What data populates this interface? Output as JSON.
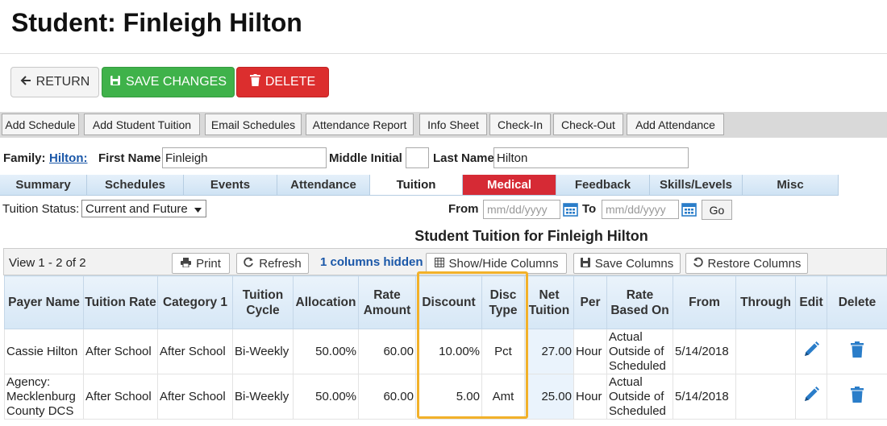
{
  "page_title": "Student: Finleigh Hilton",
  "actions": {
    "return_label": "RETURN",
    "save_label": "SAVE CHANGES",
    "delete_label": "DELETE"
  },
  "toolbar": [
    "Add Schedule",
    "Add Student Tuition",
    "Email Schedules",
    "Attendance Report",
    "Info Sheet",
    "Check-In",
    "Check-Out",
    "Add Attendance"
  ],
  "student": {
    "family_label": "Family:",
    "family_link": "Hilton:",
    "first_name_label": "First Name",
    "first_name": "Finleigh",
    "middle_initial_label": "Middle Initial",
    "middle_initial": "",
    "last_name_label": "Last Name",
    "last_name": "Hilton"
  },
  "tabs": [
    "Summary",
    "Schedules",
    "Events",
    "Attendance",
    "Tuition",
    "Medical",
    "Feedback",
    "Skills/Levels",
    "Misc"
  ],
  "active_tab": "Tuition",
  "filters": {
    "status_label": "Tuition Status:",
    "status_value": "Current and Future",
    "from_label": "From",
    "to_label": "To",
    "date_placeholder": "mm/dd/yyyy",
    "go_label": "Go"
  },
  "grid": {
    "title": "Student Tuition for Finleigh Hilton",
    "view_text": "View 1 - 2 of 2",
    "print_label": "Print",
    "refresh_label": "Refresh",
    "hidden_text": "1 columns hidden",
    "show_hide_label": "Show/Hide Columns",
    "save_columns_label": "Save Columns",
    "restore_columns_label": "Restore Columns",
    "columns": [
      "Payer Name",
      "Tuition Rate",
      "Category 1",
      "Tuition Cycle",
      "Allocation",
      "Rate Amount",
      "Discount",
      "Disc Type",
      "Net Tuition",
      "Per",
      "Rate Based On",
      "From",
      "Through",
      "Edit",
      "Delete"
    ],
    "rows": [
      [
        "Cassie Hilton",
        "After School",
        "After School",
        "Bi-Weekly",
        "50.00%",
        "60.00",
        "10.00%",
        "Pct",
        "27.00",
        "Hour",
        "Actual Outside of Scheduled",
        "5/14/2018",
        ""
      ],
      [
        "Agency: Mecklenburg County DCS",
        "After School",
        "After School",
        "Bi-Weekly",
        "50.00%",
        "60.00",
        "5.00",
        "Amt",
        "25.00",
        "Hour",
        "Actual Outside of Scheduled",
        "5/14/2018",
        ""
      ]
    ]
  },
  "colors": {
    "save": "#3fb24a",
    "delete": "#dc2e2e",
    "link": "#1a57a8",
    "medical_tab": "#d62a35",
    "highlight": "#f2b12a"
  },
  "icons": [
    "arrow-left-icon",
    "save-disk-icon",
    "trash-icon",
    "calendar-icon",
    "print-icon",
    "refresh-icon",
    "columns-icon",
    "pencil-icon"
  ]
}
